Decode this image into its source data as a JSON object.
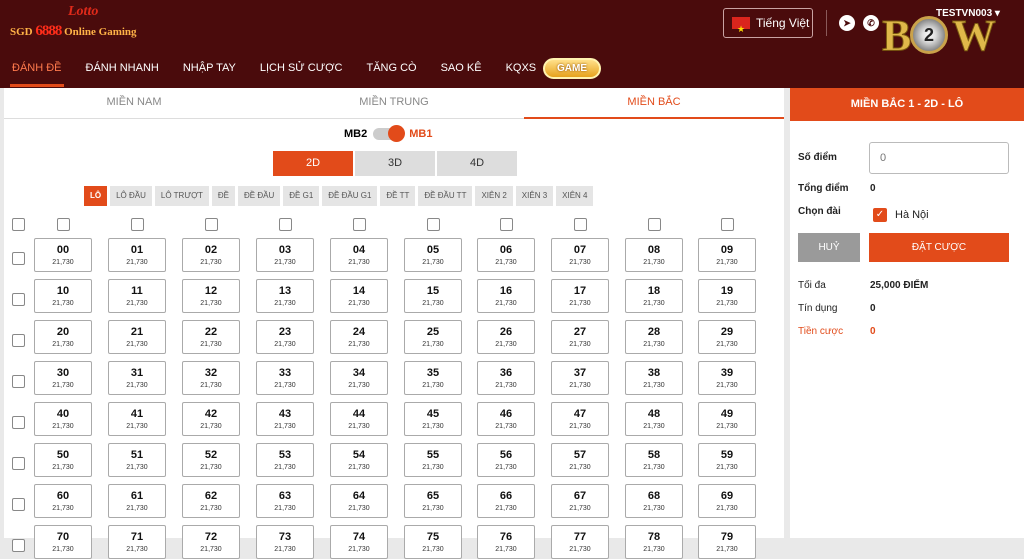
{
  "logo": {
    "top": "Lotto",
    "prefix": "SGD",
    "num": "6888",
    "suffix": "Online Gaming"
  },
  "nav": [
    {
      "label": "Đánh đề",
      "active": true
    },
    {
      "label": "Đánh nhanh"
    },
    {
      "label": "Nhập tay"
    },
    {
      "label": "Lịch sử cược"
    },
    {
      "label": "Tăng cò"
    },
    {
      "label": "Sao kê"
    },
    {
      "label": "KQXS"
    }
  ],
  "game_label": "GAME",
  "language": "Tiếng Việt",
  "user": {
    "name": "TESTVN003"
  },
  "badge": {
    "left": "B",
    "num": "2",
    "right": "W"
  },
  "regions": [
    {
      "label": "Miền Nam"
    },
    {
      "label": "Miền Trung"
    },
    {
      "label": "Miền Bắc",
      "active": true
    }
  ],
  "toggle": {
    "left": "MB2",
    "right": "MB1"
  },
  "dims": [
    {
      "label": "2D",
      "active": true
    },
    {
      "label": "3D"
    },
    {
      "label": "4D"
    }
  ],
  "types": [
    {
      "label": "Lô",
      "active": true
    },
    {
      "label": "Lô đầu"
    },
    {
      "label": "Lô trượt"
    },
    {
      "label": "Đề"
    },
    {
      "label": "Đề đầu"
    },
    {
      "label": "Đề G1"
    },
    {
      "label": "Đề đầu G1"
    },
    {
      "label": "Đề TT"
    },
    {
      "label": "Đề đầu TT"
    },
    {
      "label": "Xiên 2"
    },
    {
      "label": "Xiên 3"
    },
    {
      "label": "Xiên 4"
    }
  ],
  "grid": {
    "odds": "21,730",
    "rows": [
      [
        "00",
        "01",
        "02",
        "03",
        "04",
        "05",
        "06",
        "07",
        "08",
        "09"
      ],
      [
        "10",
        "11",
        "12",
        "13",
        "14",
        "15",
        "16",
        "17",
        "18",
        "19"
      ],
      [
        "20",
        "21",
        "22",
        "23",
        "24",
        "25",
        "26",
        "27",
        "28",
        "29"
      ],
      [
        "30",
        "31",
        "32",
        "33",
        "34",
        "35",
        "36",
        "37",
        "38",
        "39"
      ],
      [
        "40",
        "41",
        "42",
        "43",
        "44",
        "45",
        "46",
        "47",
        "48",
        "49"
      ],
      [
        "50",
        "51",
        "52",
        "53",
        "54",
        "55",
        "56",
        "57",
        "58",
        "59"
      ],
      [
        "60",
        "61",
        "62",
        "63",
        "64",
        "65",
        "66",
        "67",
        "68",
        "69"
      ],
      [
        "70",
        "71",
        "72",
        "73",
        "74",
        "75",
        "76",
        "77",
        "78",
        "79"
      ]
    ]
  },
  "panel": {
    "title": "Miền Bắc 1 - 2D - Lô",
    "points_label": "Số điểm",
    "points_placeholder": "0",
    "total_label": "Tổng điểm",
    "total_value": "0",
    "station_label": "Chọn đài",
    "station_value": "Hà Nội",
    "cancel": "Huỷ",
    "place_bet": "Đặt cược",
    "max_label": "Tối đa",
    "max_value": "25,000 ĐIỂM",
    "credit_label": "Tín dụng",
    "credit_value": "0",
    "stake_label": "Tiền cược",
    "stake_value": "0"
  }
}
